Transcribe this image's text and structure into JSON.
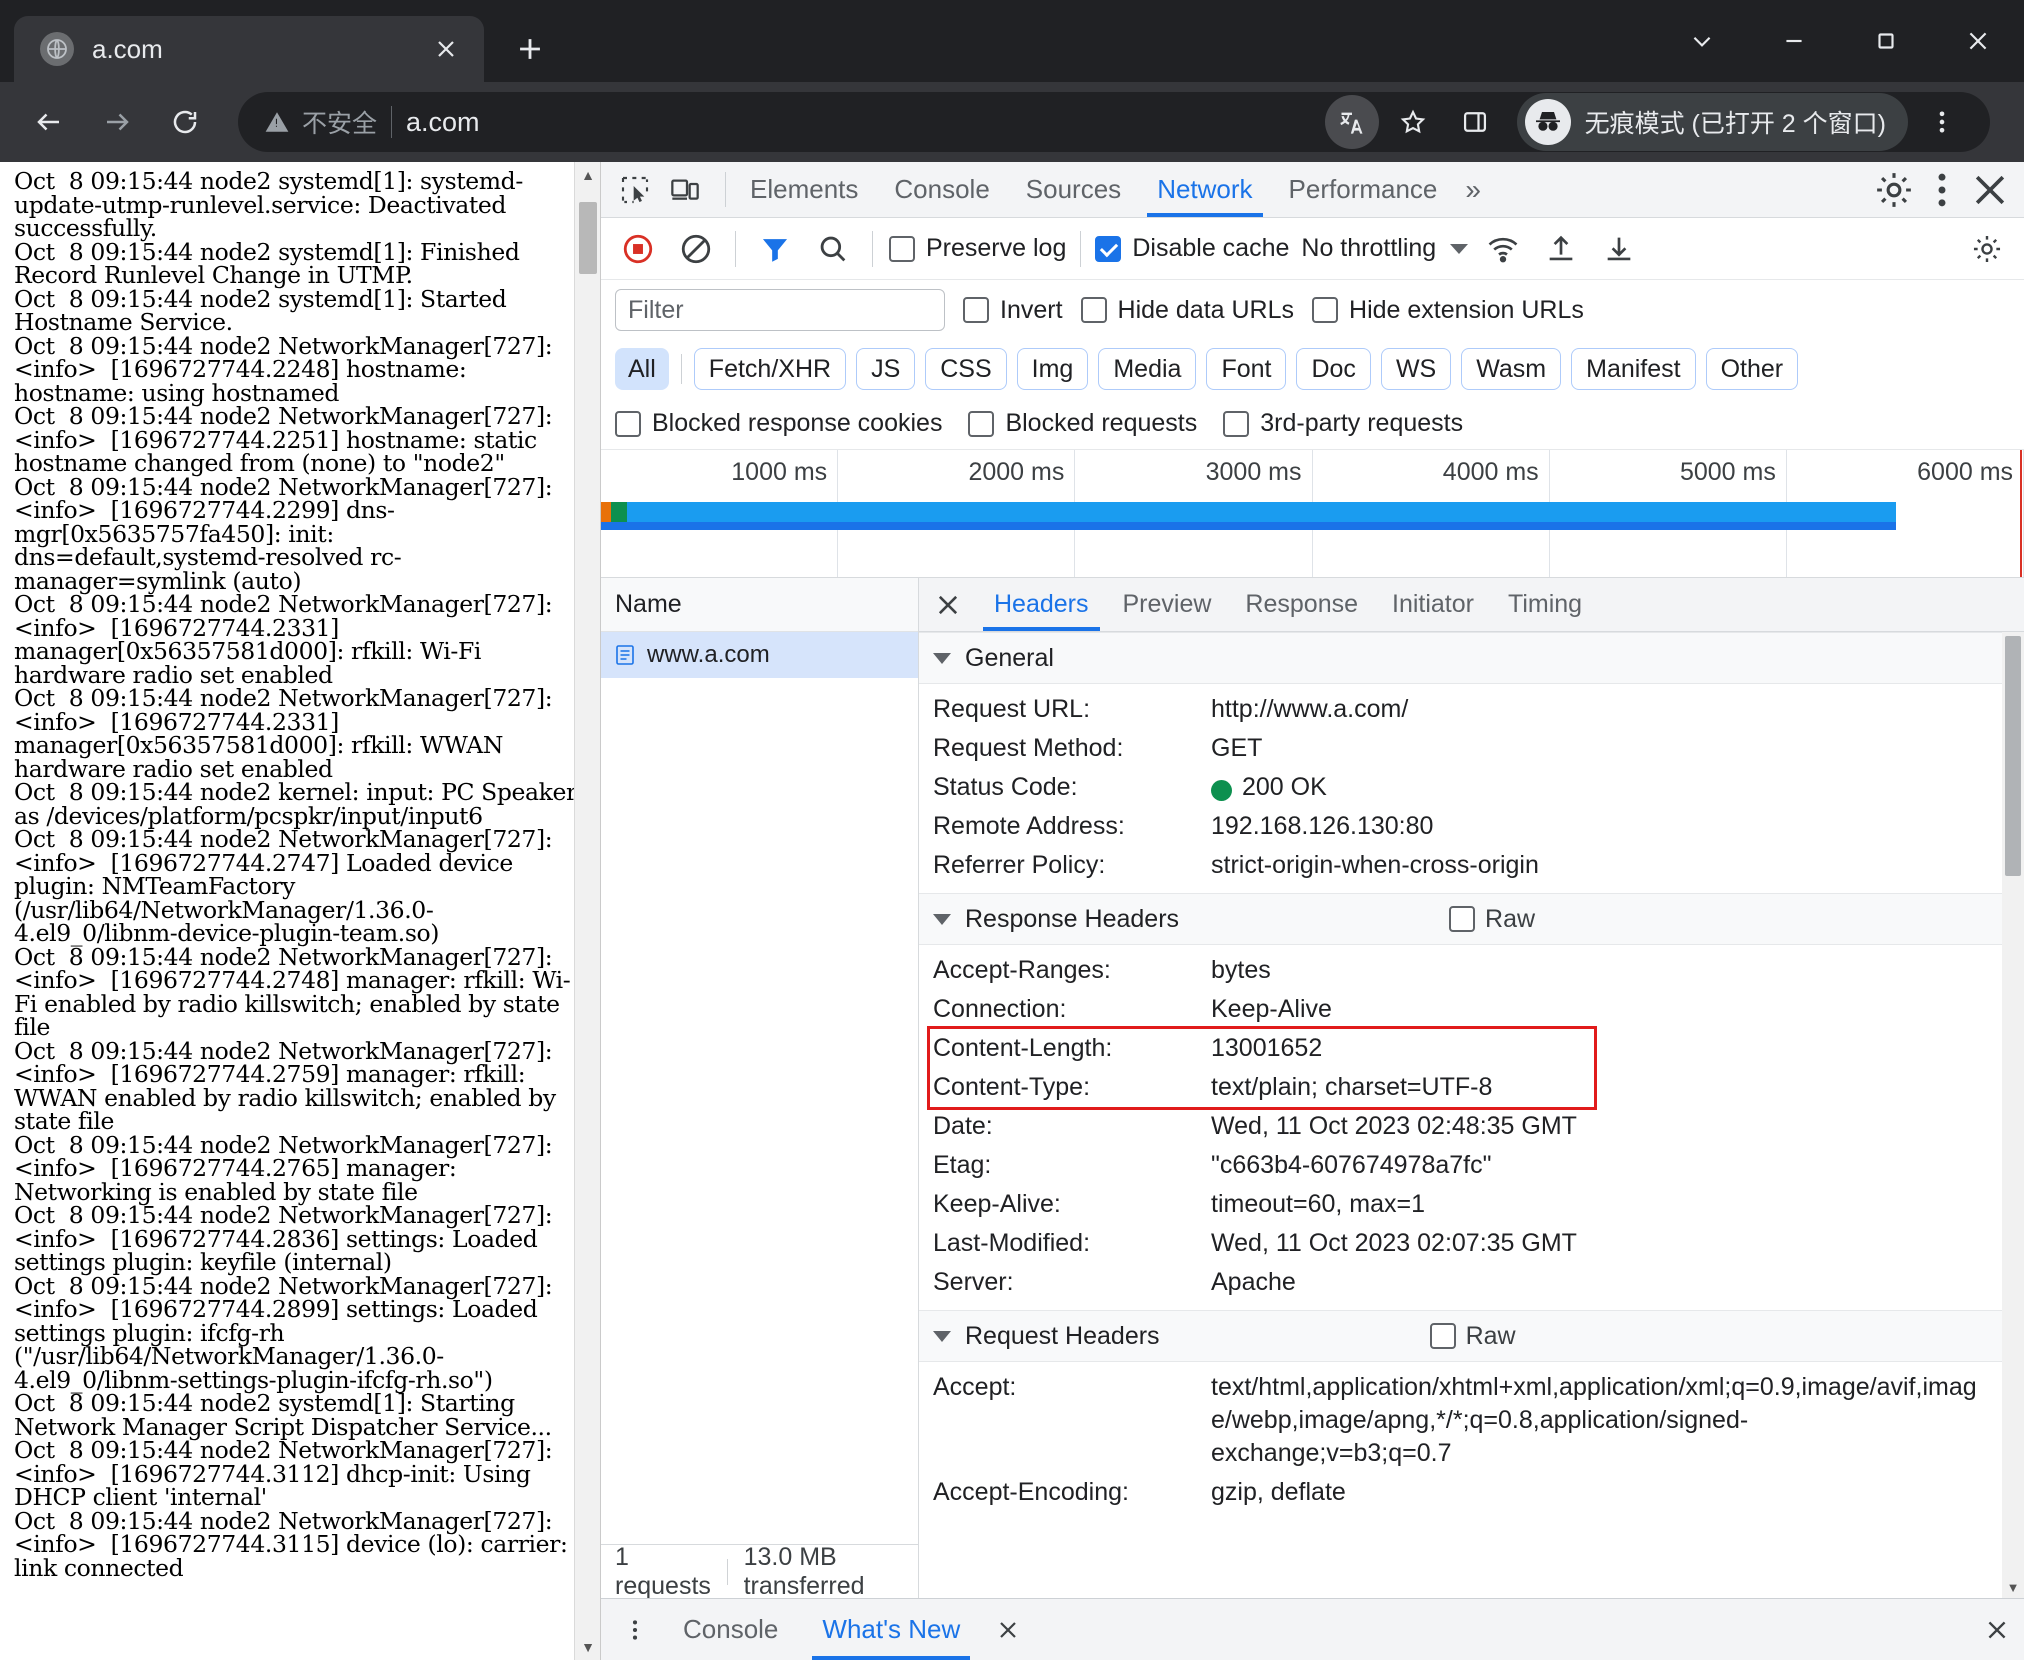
{
  "browser": {
    "tab": {
      "title": "a.com",
      "favicon_icon": "globe-icon",
      "close_icon": "close-icon"
    },
    "new_tab_icon": "plus-icon",
    "window_controls": {
      "minimize_icon": "chevron-down-icon",
      "collapse_icon": "minimize-icon",
      "maximize_icon": "maximize-icon",
      "close_icon": "close-icon"
    },
    "nav": {
      "back_icon": "arrow-left-icon",
      "forward_icon": "arrow-right-icon",
      "reload_icon": "reload-icon"
    },
    "omnibox": {
      "security_label": "不安全",
      "security_icon": "warning-triangle-icon",
      "url": "a.com",
      "translate_icon": "translate-icon",
      "bookmark_icon": "star-icon",
      "sidepanel_icon": "side-panel-icon"
    },
    "incognito": {
      "label": "无痕模式 (已打开 2 个窗口)",
      "icon": "incognito-icon"
    },
    "menu_icon": "three-dots-vertical-icon"
  },
  "page": {
    "log": "Oct  8 09:15:44 node2 systemd[1]: systemd-update-utmp-runlevel.service: Deactivated successfully.\nOct  8 09:15:44 node2 systemd[1]: Finished Record Runlevel Change in UTMP.\nOct  8 09:15:44 node2 systemd[1]: Started Hostname Service.\nOct  8 09:15:44 node2 NetworkManager[727]: <info>  [1696727744.2248] hostname: hostname: using hostnamed\nOct  8 09:15:44 node2 NetworkManager[727]: <info>  [1696727744.2251] hostname: static hostname changed from (none) to \"node2\"\nOct  8 09:15:44 node2 NetworkManager[727]: <info>  [1696727744.2299] dns-mgr[0x5635757fa450]: init: dns=default,systemd-resolved rc-manager=symlink (auto)\nOct  8 09:15:44 node2 NetworkManager[727]: <info>  [1696727744.2331] manager[0x56357581d000]: rfkill: Wi-Fi hardware radio set enabled\nOct  8 09:15:44 node2 NetworkManager[727]: <info>  [1696727744.2331] manager[0x56357581d000]: rfkill: WWAN hardware radio set enabled\nOct  8 09:15:44 node2 kernel: input: PC Speaker as /devices/platform/pcspkr/input/input6\nOct  8 09:15:44 node2 NetworkManager[727]: <info>  [1696727744.2747] Loaded device plugin: NMTeamFactory (/usr/lib64/NetworkManager/1.36.0-4.el9_0/libnm-device-plugin-team.so)\nOct  8 09:15:44 node2 NetworkManager[727]: <info>  [1696727744.2748] manager: rfkill: Wi-Fi enabled by radio killswitch; enabled by state file\nOct  8 09:15:44 node2 NetworkManager[727]: <info>  [1696727744.2759] manager: rfkill: WWAN enabled by radio killswitch; enabled by state file\nOct  8 09:15:44 node2 NetworkManager[727]: <info>  [1696727744.2765] manager: Networking is enabled by state file\nOct  8 09:15:44 node2 NetworkManager[727]: <info>  [1696727744.2836] settings: Loaded settings plugin: keyfile (internal)\nOct  8 09:15:44 node2 NetworkManager[727]: <info>  [1696727744.2899] settings: Loaded settings plugin: ifcfg-rh (\"/usr/lib64/NetworkManager/1.36.0-4.el9_0/libnm-settings-plugin-ifcfg-rh.so\")\nOct  8 09:15:44 node2 systemd[1]: Starting Network Manager Script Dispatcher Service...\nOct  8 09:15:44 node2 NetworkManager[727]: <info>  [1696727744.3112] dhcp-init: Using DHCP client 'internal'\nOct  8 09:15:44 node2 NetworkManager[727]: <info>  [1696727744.3115] device (lo): carrier: link connected"
  },
  "devtools": {
    "tool_icons": [
      "inspect-element-icon",
      "device-toolbar-icon"
    ],
    "tabs": [
      {
        "label": "Elements",
        "active": false
      },
      {
        "label": "Console",
        "active": false
      },
      {
        "label": "Sources",
        "active": false
      },
      {
        "label": "Network",
        "active": true
      },
      {
        "label": "Performance",
        "active": false
      }
    ],
    "overflow_label": "»",
    "settings_icon": "gear-icon",
    "kebab_icon": "three-dots-vertical-icon",
    "close_icon": "close-icon",
    "network_toolbar": {
      "record_icon": "record-stop-icon",
      "clear_icon": "clear-icon",
      "filter_icon": "funnel-icon",
      "search_icon": "search-icon",
      "preserve_log": {
        "label": "Preserve log",
        "checked": false
      },
      "disable_cache": {
        "label": "Disable cache",
        "checked": true
      },
      "throttling": "No throttling",
      "wifi_icon": "network-conditions-icon",
      "import_icon": "upload-icon",
      "export_icon": "download-icon",
      "capture_settings_icon": "gear-icon"
    },
    "filter_row": {
      "filter_placeholder": "Filter",
      "filter_value": "",
      "invert": {
        "label": "Invert",
        "checked": false
      },
      "hide_data_urls": {
        "label": "Hide data URLs",
        "checked": false
      },
      "hide_extension_urls": {
        "label": "Hide extension URLs",
        "checked": false
      }
    },
    "type_pills": [
      {
        "label": "All",
        "selected": true
      },
      {
        "label": "Fetch/XHR",
        "selected": false
      },
      {
        "label": "JS",
        "selected": false
      },
      {
        "label": "CSS",
        "selected": false
      },
      {
        "label": "Img",
        "selected": false
      },
      {
        "label": "Media",
        "selected": false
      },
      {
        "label": "Font",
        "selected": false
      },
      {
        "label": "Doc",
        "selected": false
      },
      {
        "label": "WS",
        "selected": false
      },
      {
        "label": "Wasm",
        "selected": false
      },
      {
        "label": "Manifest",
        "selected": false
      },
      {
        "label": "Other",
        "selected": false
      }
    ],
    "blocked_row": [
      {
        "label": "Blocked response cookies",
        "checked": false
      },
      {
        "label": "Blocked requests",
        "checked": false
      },
      {
        "label": "3rd-party requests",
        "checked": false
      }
    ],
    "overview": {
      "ticks": [
        "1000 ms",
        "2000 ms",
        "3000 ms",
        "4000 ms",
        "5000 ms",
        "6000 ms"
      ],
      "bar_percent": 91
    },
    "request_list": {
      "column_header": "Name",
      "rows": [
        {
          "name": "www.a.com",
          "icon": "document-icon",
          "selected": true
        }
      ],
      "footer": {
        "requests": "1 requests",
        "transferred": "13.0 MB transferred"
      }
    },
    "detail": {
      "tabs": [
        {
          "label": "Headers",
          "active": true
        },
        {
          "label": "Preview",
          "active": false
        },
        {
          "label": "Response",
          "active": false
        },
        {
          "label": "Initiator",
          "active": false
        },
        {
          "label": "Timing",
          "active": false
        }
      ],
      "close_icon": "close-icon",
      "sections": [
        {
          "title": "General",
          "raw": null,
          "rows": [
            {
              "key": "Request URL:",
              "value": "http://www.a.com/"
            },
            {
              "key": "Request Method:",
              "value": "GET"
            },
            {
              "key": "Status Code:",
              "value": "200 OK",
              "dot": "#0d904f"
            },
            {
              "key": "Remote Address:",
              "value": "192.168.126.130:80"
            },
            {
              "key": "Referrer Policy:",
              "value": "strict-origin-when-cross-origin"
            }
          ]
        },
        {
          "title": "Response Headers",
          "raw": {
            "label": "Raw",
            "checked": false
          },
          "rows": [
            {
              "key": "Accept-Ranges:",
              "value": "bytes"
            },
            {
              "key": "Connection:",
              "value": "Keep-Alive"
            },
            {
              "key": "Content-Length:",
              "value": "13001652",
              "highlighted": true
            },
            {
              "key": "Content-Type:",
              "value": "text/plain; charset=UTF-8",
              "highlighted": true
            },
            {
              "key": "Date:",
              "value": "Wed, 11 Oct 2023 02:48:35 GMT"
            },
            {
              "key": "Etag:",
              "value": "\"c663b4-607674978a7fc\""
            },
            {
              "key": "Keep-Alive:",
              "value": "timeout=60, max=1"
            },
            {
              "key": "Last-Modified:",
              "value": "Wed, 11 Oct 2023 02:07:35 GMT"
            },
            {
              "key": "Server:",
              "value": "Apache"
            }
          ]
        },
        {
          "title": "Request Headers",
          "raw": {
            "label": "Raw",
            "checked": false
          },
          "rows": [
            {
              "key": "Accept:",
              "value": "text/html,application/xhtml+xml,application/xml;q=0.9,image/avif,image/webp,image/apng,*/*;q=0.8,application/signed-exchange;v=b3;q=0.7"
            },
            {
              "key": "Accept-Encoding:",
              "value": "gzip, deflate"
            }
          ]
        }
      ]
    },
    "drawer": {
      "more_icon": "three-dots-vertical-icon",
      "tabs": [
        {
          "label": "Console",
          "active": false
        },
        {
          "label": "What's New",
          "active": true
        }
      ],
      "close_icon": "close-icon",
      "drawer_close_icon": "close-icon"
    }
  },
  "colors": {
    "accent": "#1a73e8",
    "status_ok": "#0d904f",
    "highlight_box": "#e11b1b",
    "chrome_bg": "#35363a"
  }
}
